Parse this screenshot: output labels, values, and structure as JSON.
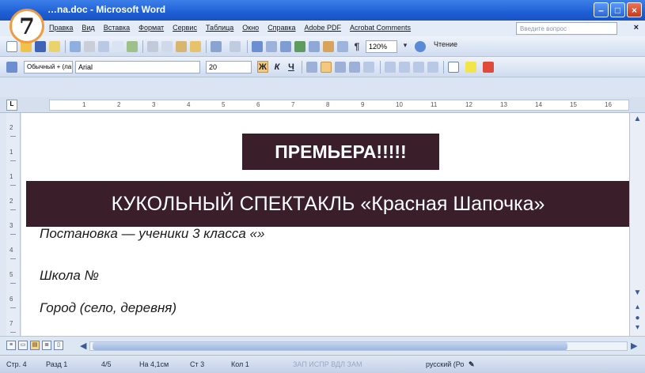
{
  "badge": {
    "number": "7"
  },
  "window": {
    "title": "…na.doc - Microsoft Word"
  },
  "menu": {
    "items": [
      "Правка",
      "Вид",
      "Вставка",
      "Формат",
      "Сервис",
      "Таблица",
      "Окно",
      "Справка",
      "Adobe PDF",
      "Acrobat Comments"
    ],
    "help_placeholder": "Введите вопрос",
    "close_doc": "×"
  },
  "toolbar_standard": {
    "zoom": "120%",
    "reading_label": "Чтение"
  },
  "toolbar_format": {
    "style": "Обычный + (ла",
    "font": "Arial",
    "size": "20"
  },
  "ruler": {
    "numbers": [
      "1",
      "2",
      "3",
      "4",
      "5",
      "6",
      "7",
      "8",
      "9",
      "10",
      "11",
      "12",
      "13",
      "14",
      "15",
      "16"
    ]
  },
  "vruler": {
    "numbers": [
      "2",
      "1",
      "1",
      "2",
      "3",
      "4",
      "5",
      "6",
      "7"
    ]
  },
  "document": {
    "headline1": "ПРЕМЬЕРА!!!!!",
    "headline2": "КУКОЛЬНЫЙ СПЕКТАКЛЬ «Красная Шапочка»",
    "line1": "Постановка — ученики 3 класса «»",
    "line2": "Школа №",
    "line3": "Город (село, деревня)",
    "headline_bg": "#3a1f2a"
  },
  "statusbar": {
    "page": "Стр. 4",
    "section": "Разд 1",
    "pages": "4/5",
    "position": "На 4,1см",
    "line": "Ст 3",
    "column": "Кол 1",
    "disabled": "ЗАП ИСПР ВДЛ ЗАМ",
    "language": "русский (Ро"
  }
}
